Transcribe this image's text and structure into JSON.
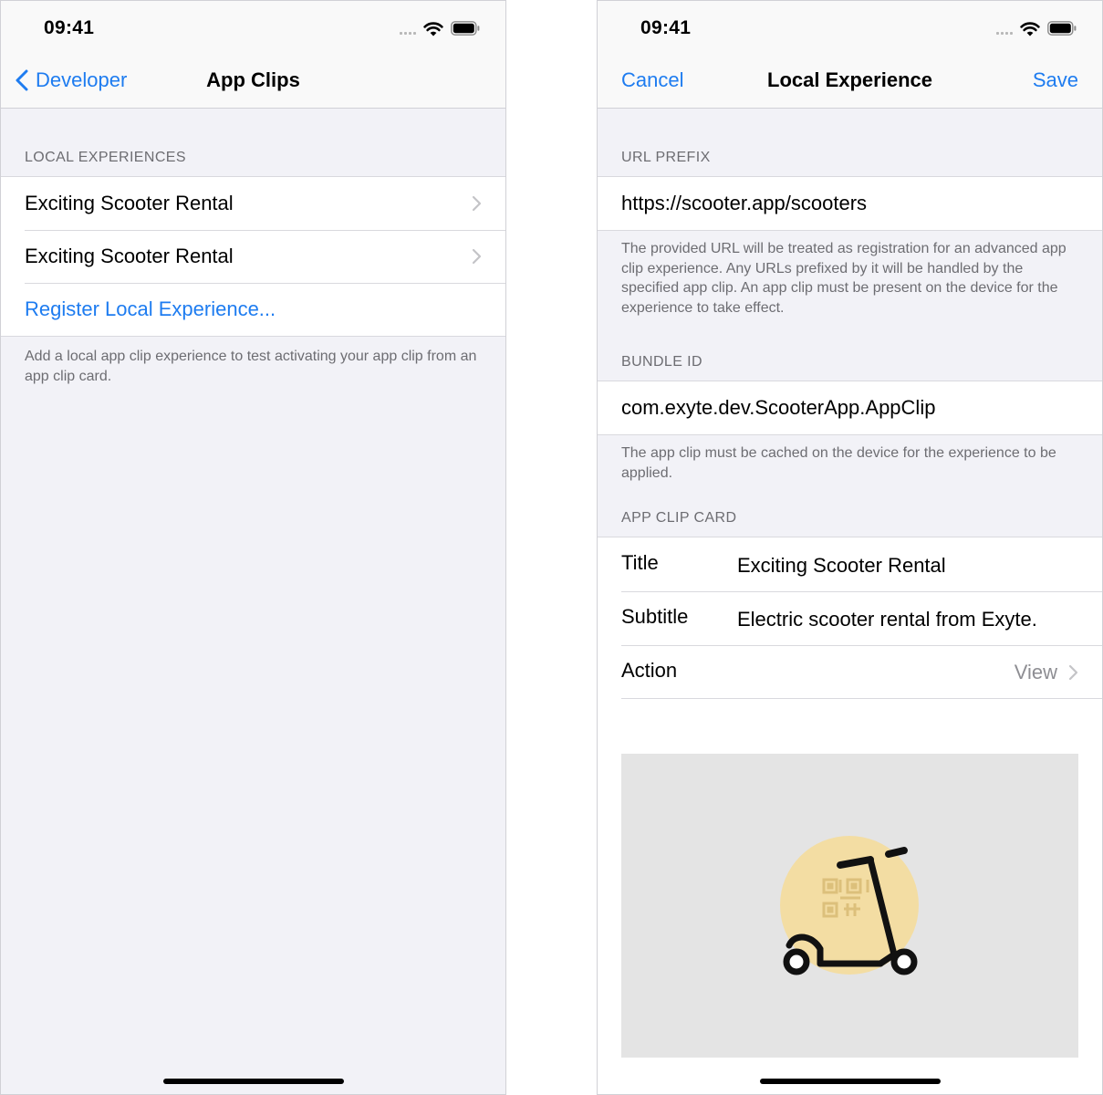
{
  "status": {
    "time": "09:41"
  },
  "left": {
    "nav": {
      "back_label": "Developer",
      "title": "App Clips"
    },
    "local_experiences": {
      "header": "LOCAL EXPERIENCES",
      "items": [
        {
          "label": "Exciting Scooter Rental"
        },
        {
          "label": "Exciting Scooter Rental"
        }
      ],
      "register_label": "Register Local Experience...",
      "footer": "Add a local app clip experience to test activating your app clip from an app clip card."
    }
  },
  "right": {
    "nav": {
      "cancel_label": "Cancel",
      "title": "Local Experience",
      "save_label": "Save"
    },
    "url_prefix": {
      "header": "URL PREFIX",
      "value": "https://scooter.app/scooters",
      "footer": "The provided URL will be treated as registration for an advanced app clip experience. Any URLs prefixed by it will be handled by the specified app clip. An app clip must be present on the device for the experience to take effect."
    },
    "bundle_id": {
      "header": "BUNDLE ID",
      "value": "com.exyte.dev.ScooterApp.AppClip",
      "footer": "The app clip must be cached on the device for the experience to be applied."
    },
    "app_clip_card": {
      "header": "APP CLIP CARD",
      "title_key": "Title",
      "title_value": "Exciting Scooter Rental",
      "subtitle_key": "Subtitle",
      "subtitle_value": "Electric scooter rental from Exyte.",
      "action_key": "Action",
      "action_value": "View"
    }
  },
  "colors": {
    "accent": "#1e7cf0",
    "background": "#f2f2f7",
    "secondary_text": "#6d6d72",
    "card_image_bg": "#e4e4e4",
    "illustration_circle": "#f3dda3"
  }
}
